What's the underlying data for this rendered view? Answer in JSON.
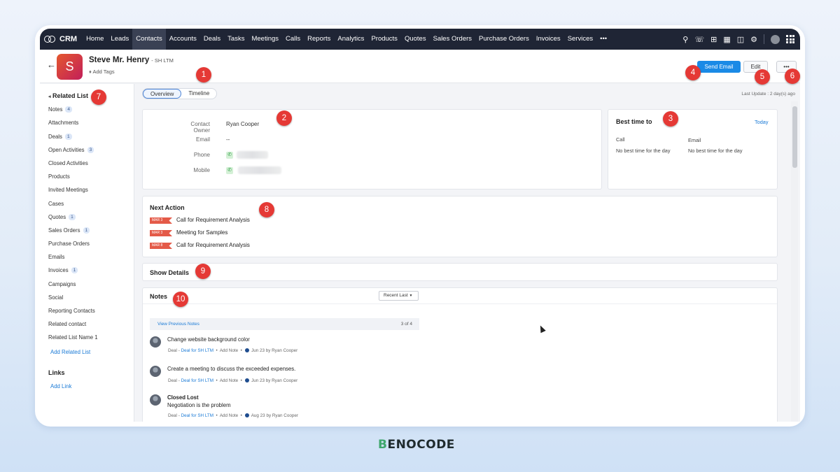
{
  "nav": {
    "brand": "CRM",
    "items": [
      "Home",
      "Leads",
      "Contacts",
      "Accounts",
      "Deals",
      "Tasks",
      "Meetings",
      "Calls",
      "Reports",
      "Analytics",
      "Products",
      "Quotes",
      "Sales Orders",
      "Purchase Orders",
      "Invoices",
      "Services",
      "•••"
    ],
    "active": "Contacts"
  },
  "contact": {
    "initial": "S",
    "name": "Steve Mr. Henry",
    "account": "- SH LTM",
    "add_tags": "Add Tags"
  },
  "actions": {
    "send_email": "Send Email",
    "edit": "Edit",
    "more": "•••"
  },
  "tabs": [
    "Overview",
    "Timeline"
  ],
  "last_update": "Last Update : 2 day(s) ago",
  "sidebar": {
    "title": "Related List",
    "items": [
      {
        "label": "Notes",
        "count": "4"
      },
      {
        "label": "Attachments"
      },
      {
        "label": "Deals",
        "count": "1"
      },
      {
        "label": "Open Activities",
        "count": "3"
      },
      {
        "label": "Closed Activities"
      },
      {
        "label": "Products"
      },
      {
        "label": "Invited Meetings"
      },
      {
        "label": "Cases"
      },
      {
        "label": "Quotes",
        "count": "1"
      },
      {
        "label": "Sales Orders",
        "count": "1"
      },
      {
        "label": "Purchase Orders"
      },
      {
        "label": "Emails"
      },
      {
        "label": "Invoices",
        "count": "1"
      },
      {
        "label": "Campaigns"
      },
      {
        "label": "Social"
      },
      {
        "label": "Reporting Contacts"
      },
      {
        "label": "Related contact"
      },
      {
        "label": "Related List Name 1"
      }
    ],
    "add_related": "Add Related List",
    "links_title": "Links",
    "add_link": "Add Link"
  },
  "details": {
    "owner_label": "Contact Owner",
    "owner_value": "Ryan Cooper",
    "email_label": "Email",
    "email_value": "--",
    "phone_label": "Phone",
    "mobile_label": "Mobile"
  },
  "best_time": {
    "title": "Best time to",
    "today": "Today",
    "call_label": "Call",
    "call_value": "No best time for the day",
    "email_label": "Email",
    "email_value": "No best time for the day"
  },
  "next_action": {
    "title": "Next Action",
    "items": [
      {
        "date": "MAR 3",
        "label": "Call for Requirement Analysis"
      },
      {
        "date": "MAR 3",
        "label": "Meeting for Samples"
      },
      {
        "date": "MAR 8",
        "label": "Call for Requirement Analysis"
      }
    ]
  },
  "show_details": "Show Details",
  "notes": {
    "title": "Notes",
    "sort": "Recent Last",
    "view_previous": "View Previous Notes",
    "page": "3 of 4",
    "items": [
      {
        "title": "",
        "body": "Change website background color",
        "type": "Deal",
        "deal": "Deal for SH LTM",
        "add": "Add Note",
        "date": "Jun 23",
        "by": "by  Ryan Cooper"
      },
      {
        "title": "",
        "body": "Create a meeting to discuss the exceeded expenses.",
        "type": "Deal",
        "deal": "Deal for SH LTM",
        "add": "Add Note",
        "date": "Jun 23",
        "by": "by  Ryan Cooper"
      },
      {
        "title": "Closed Lost",
        "body": "Negotiation is the problem",
        "type": "Deal",
        "deal": "Deal for SH LTM",
        "add": "Add Note",
        "date": "Aug 23",
        "by": "by  Ryan Cooper"
      }
    ]
  },
  "callouts": [
    "1",
    "2",
    "3",
    "4",
    "5",
    "6",
    "7",
    "8",
    "9",
    "10"
  ],
  "footer_brand": {
    "prefix": "B",
    "rest": "ENOCODE"
  },
  "colors": {
    "nav_bg": "#1f2535",
    "primary": "#1a8ae6",
    "badge": "#e53935",
    "link": "#1a7ad6"
  }
}
